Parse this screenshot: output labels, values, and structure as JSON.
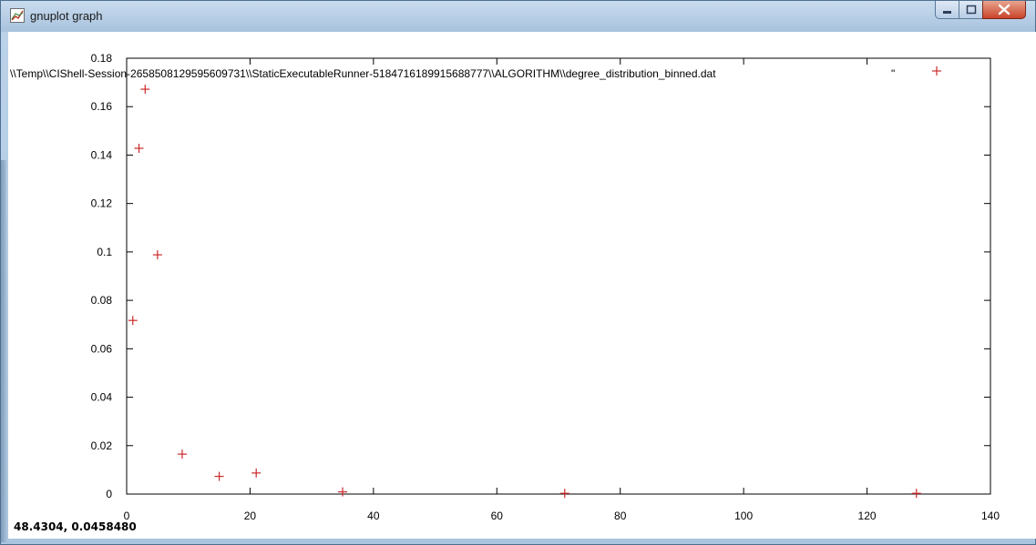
{
  "window": {
    "title": "gnuplot graph",
    "icons": {
      "app": "gnuplot-graph-icon",
      "minimize": "minimize-icon",
      "maximize": "maximize-icon",
      "close": "close-icon"
    }
  },
  "status": {
    "mouse_coords": "48.4304,  0.0458480"
  },
  "chart_data": {
    "type": "scatter",
    "title": "",
    "xlabel": "",
    "ylabel": "",
    "xlim": [
      0,
      140
    ],
    "ylim": [
      0,
      0.18
    ],
    "x_ticks": [
      "0",
      "20",
      "40",
      "60",
      "80",
      "100",
      "120",
      "140"
    ],
    "y_ticks": [
      "0",
      "0.02",
      "0.04",
      "0.06",
      "0.08",
      "0.1",
      "0.12",
      "0.14",
      "0.16",
      "0.18"
    ],
    "grid": false,
    "marker_color": "#cc2a2a",
    "legend": {
      "placement": "top",
      "label": "\\\\Temp\\\\CIShell-Session-2658508129595609731\\\\StaticExecutableRunner-5184716189915688777\\\\ALGORITHM\\\\degree_distribution_binned.dat",
      "quote": "\""
    },
    "series": [
      {
        "x": [
          1,
          2,
          3,
          5,
          9,
          15,
          21,
          35,
          71,
          128
        ],
        "y": [
          0.0717,
          0.1428,
          0.1672,
          0.0988,
          0.0165,
          0.0073,
          0.0087,
          0.0009,
          0.0003,
          0.0003
        ]
      }
    ]
  }
}
